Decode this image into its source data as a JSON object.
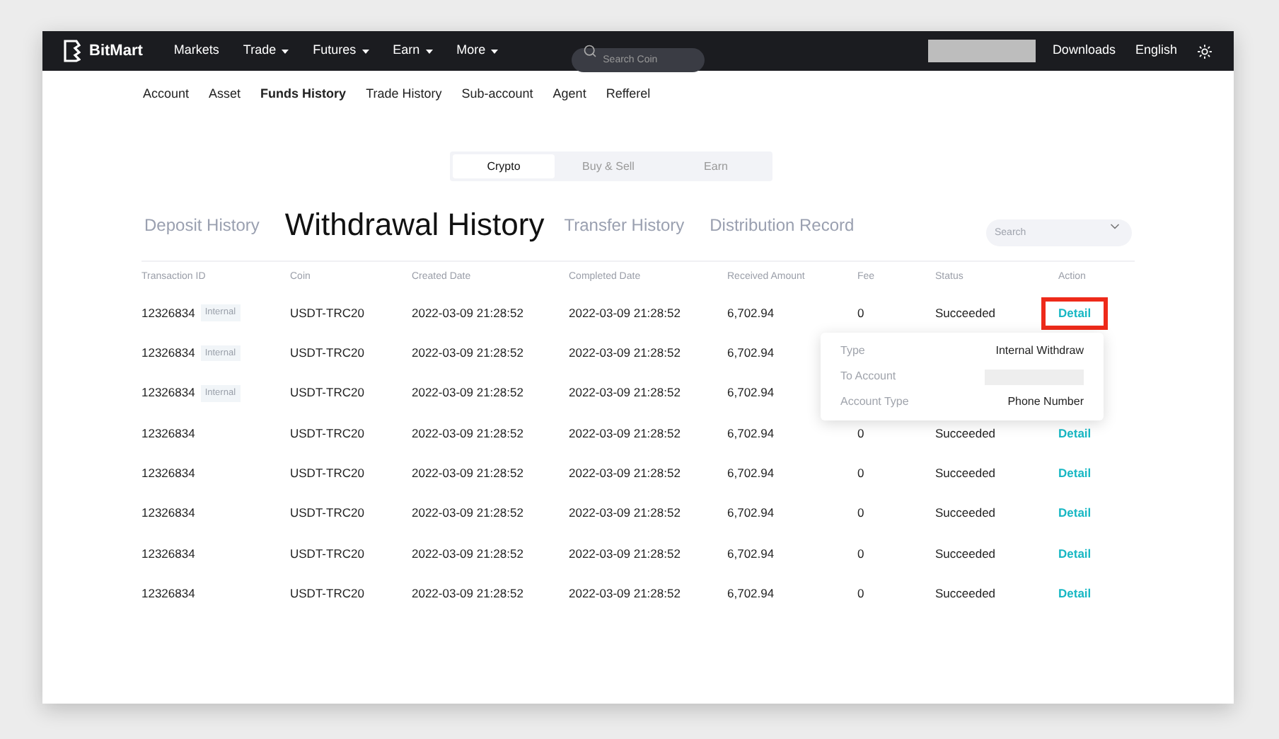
{
  "navbar": {
    "brand": "BitMart",
    "menu": [
      {
        "label": "Markets",
        "dropdown": false
      },
      {
        "label": "Trade",
        "dropdown": true
      },
      {
        "label": "Futures",
        "dropdown": true
      },
      {
        "label": "Earn",
        "dropdown": true
      },
      {
        "label": "More",
        "dropdown": true
      }
    ],
    "search": {
      "placeholder": "Search Coin"
    },
    "links": [
      "Downloads",
      "English"
    ]
  },
  "subnav": [
    {
      "label": "Account",
      "selected": false
    },
    {
      "label": "Asset",
      "selected": false
    },
    {
      "label": "Funds History",
      "selected": true
    },
    {
      "label": "Trade History",
      "selected": false
    },
    {
      "label": "Sub-account",
      "selected": false
    },
    {
      "label": "Agent",
      "selected": false
    },
    {
      "label": "Refferel",
      "selected": false
    }
  ],
  "segments": [
    {
      "label": "Crypto",
      "selected": true
    },
    {
      "label": "Buy & Sell",
      "selected": false
    },
    {
      "label": "Earn",
      "selected": false
    }
  ],
  "history_tabs": [
    {
      "label": "Deposit History",
      "selected": false
    },
    {
      "label": "Withdrawal History",
      "selected": true
    },
    {
      "label": "Transfer History",
      "selected": false
    },
    {
      "label": "Distribution Record",
      "selected": false
    }
  ],
  "filter": {
    "placeholder": "Search"
  },
  "table": {
    "columns": [
      "Transaction ID",
      "Coin",
      "Created Date",
      "Completed Date",
      "Received Amount",
      "Fee",
      "Status",
      "Action"
    ],
    "rows": [
      {
        "id": "12326834",
        "tag": "Internal",
        "coin": "USDT-TRC20",
        "created": "2022-03-09 21:28:52",
        "completed": "2022-03-09 21:28:52",
        "amount": "6,702.94",
        "fee": "0",
        "status": "Succeeded",
        "action": "Detail",
        "highlighted": true
      },
      {
        "id": "12326834",
        "tag": "Internal",
        "coin": "USDT-TRC20",
        "created": "2022-03-09 21:28:52",
        "completed": "2022-03-09 21:28:52",
        "amount": "6,702.94"
      },
      {
        "id": "12326834",
        "tag": "Internal",
        "coin": "USDT-TRC20",
        "created": "2022-03-09 21:28:52",
        "completed": "2022-03-09 21:28:52",
        "amount": "6,702.94"
      },
      {
        "id": "12326834",
        "coin": "USDT-TRC20",
        "created": "2022-03-09 21:28:52",
        "completed": "2022-03-09 21:28:52",
        "amount": "6,702.94",
        "fee": "0",
        "status": "Succeeded",
        "action": "Detail",
        "highlighted": false
      },
      {
        "id": "12326834",
        "coin": "USDT-TRC20",
        "created": "2022-03-09 21:28:52",
        "completed": "2022-03-09 21:28:52",
        "amount": "6,702.94",
        "fee": "0",
        "status": "Succeeded",
        "action": "Detail",
        "highlighted": false
      },
      {
        "id": "12326834",
        "coin": "USDT-TRC20",
        "created": "2022-03-09 21:28:52",
        "completed": "2022-03-09 21:28:52",
        "amount": "6,702.94",
        "fee": "0",
        "status": "Succeeded",
        "action": "Detail",
        "highlighted": false
      },
      {
        "id": "12326834",
        "coin": "USDT-TRC20",
        "created": "2022-03-09 21:28:52",
        "completed": "2022-03-09 21:28:52",
        "amount": "6,702.94",
        "fee": "0",
        "status": "Succeeded",
        "action": "Detail",
        "highlighted": false
      },
      {
        "id": "12326834",
        "coin": "USDT-TRC20",
        "created": "2022-03-09 21:28:52",
        "completed": "2022-03-09 21:28:52",
        "amount": "6,702.94",
        "fee": "0",
        "status": "Succeeded",
        "action": "Detail",
        "highlighted": false
      }
    ]
  },
  "detail_popup": [
    {
      "label": "Type",
      "value": "Internal Withdraw",
      "redacted": false
    },
    {
      "label": "To Account",
      "redacted": true
    },
    {
      "label": "Account Type",
      "value": "Phone Number",
      "redacted": false
    }
  ]
}
